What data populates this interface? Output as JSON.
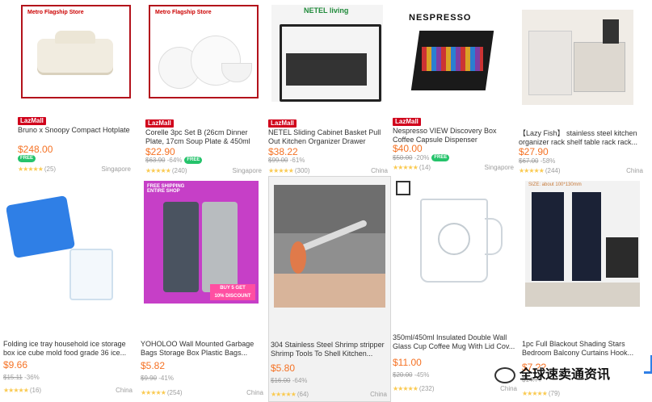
{
  "products": [
    {
      "badge": "LazMall",
      "title": "Bruno x Snoopy Compact Hotplate",
      "price": "$248.00",
      "orig": "",
      "discount": "",
      "free": "FREE",
      "rating": "(25)",
      "location": "Singapore",
      "brand": "Metro Flagship Store"
    },
    {
      "badge": "LazMall",
      "title": "Corelle 3pc Set B (26cm Dinner Plate, 17cm Soup Plate & 450ml Bowl)...",
      "price": "$22.90",
      "orig": "$63.90",
      "discount": "-64%",
      "free": "FREE",
      "rating": "(240)",
      "location": "Singapore",
      "brand": "Metro Flagship Store"
    },
    {
      "badge": "LazMall",
      "title": "NETEL Sliding Cabinet Basket Pull Out Kitchen Organizer Drawer Ideal...",
      "price": "$38.22",
      "orig": "$99.00",
      "discount": "-61%",
      "free": "",
      "rating": "(300)",
      "location": "China",
      "brand": "NETEL living"
    },
    {
      "badge": "LazMall",
      "title": "Nespresso VIEW Discovery Box Coffee Capsule Dispenser (Without...",
      "price": "$40.00",
      "orig": "$50.00",
      "discount": "-20%",
      "free": "FREE",
      "rating": "(14)",
      "location": "Singapore",
      "brand": "NESPRESSO"
    },
    {
      "badge": "",
      "title": "【Lazy Fish】 stainless steel kitchen organizer rack shelf table rack rack...",
      "price": "$27.90",
      "orig": "$67.00",
      "discount": "-58%",
      "free": "",
      "rating": "(244)",
      "location": "China",
      "brand": ""
    },
    {
      "badge": "",
      "title": "Folding ice tray household ice storage box ice cube mold food grade 36 ice...",
      "price": "$9.66",
      "orig": "$15.11",
      "discount": "-36%",
      "free": "",
      "rating": "(16)",
      "location": "China",
      "brand": ""
    },
    {
      "badge": "",
      "title": "YOHOLOO Wall Mounted Garbage Bags Storage Box Plastic Bags...",
      "price": "$5.82",
      "orig": "$9.90",
      "discount": "-41%",
      "free": "",
      "rating": "(254)",
      "location": "China",
      "brand": "FREE SHIPPING ENTIRE SHOP"
    },
    {
      "badge": "",
      "title": "304 Stainless Steel Shrimp stripper Shrimp Tools To Shell Kitchen...",
      "price": "$5.80",
      "orig": "$16.00",
      "discount": "-64%",
      "free": "",
      "rating": "(64)",
      "location": "China",
      "brand": ""
    },
    {
      "badge": "",
      "title": "350ml/450ml Insulated Double Wall Glass Cup Coffee Mug With Lid Cov...",
      "price": "$11.00",
      "orig": "$20.00",
      "discount": "-45%",
      "free": "",
      "rating": "(232)",
      "location": "China",
      "brand": ""
    },
    {
      "badge": "",
      "title": "1pc Full Blackout Shading Stars Bedroom Balcony Curtains Hook...",
      "price": "$7.??",
      "orig": "$14.??",
      "discount": "",
      "free": "",
      "rating": "(79)",
      "location": "",
      "brand": "SIZE: about 100*130mm"
    }
  ],
  "watermark": "全球速卖通资讯",
  "colors": {
    "accent": "#f57224",
    "lazmall": "#d0011b",
    "free": "#25c36b",
    "star": "#faca51"
  }
}
